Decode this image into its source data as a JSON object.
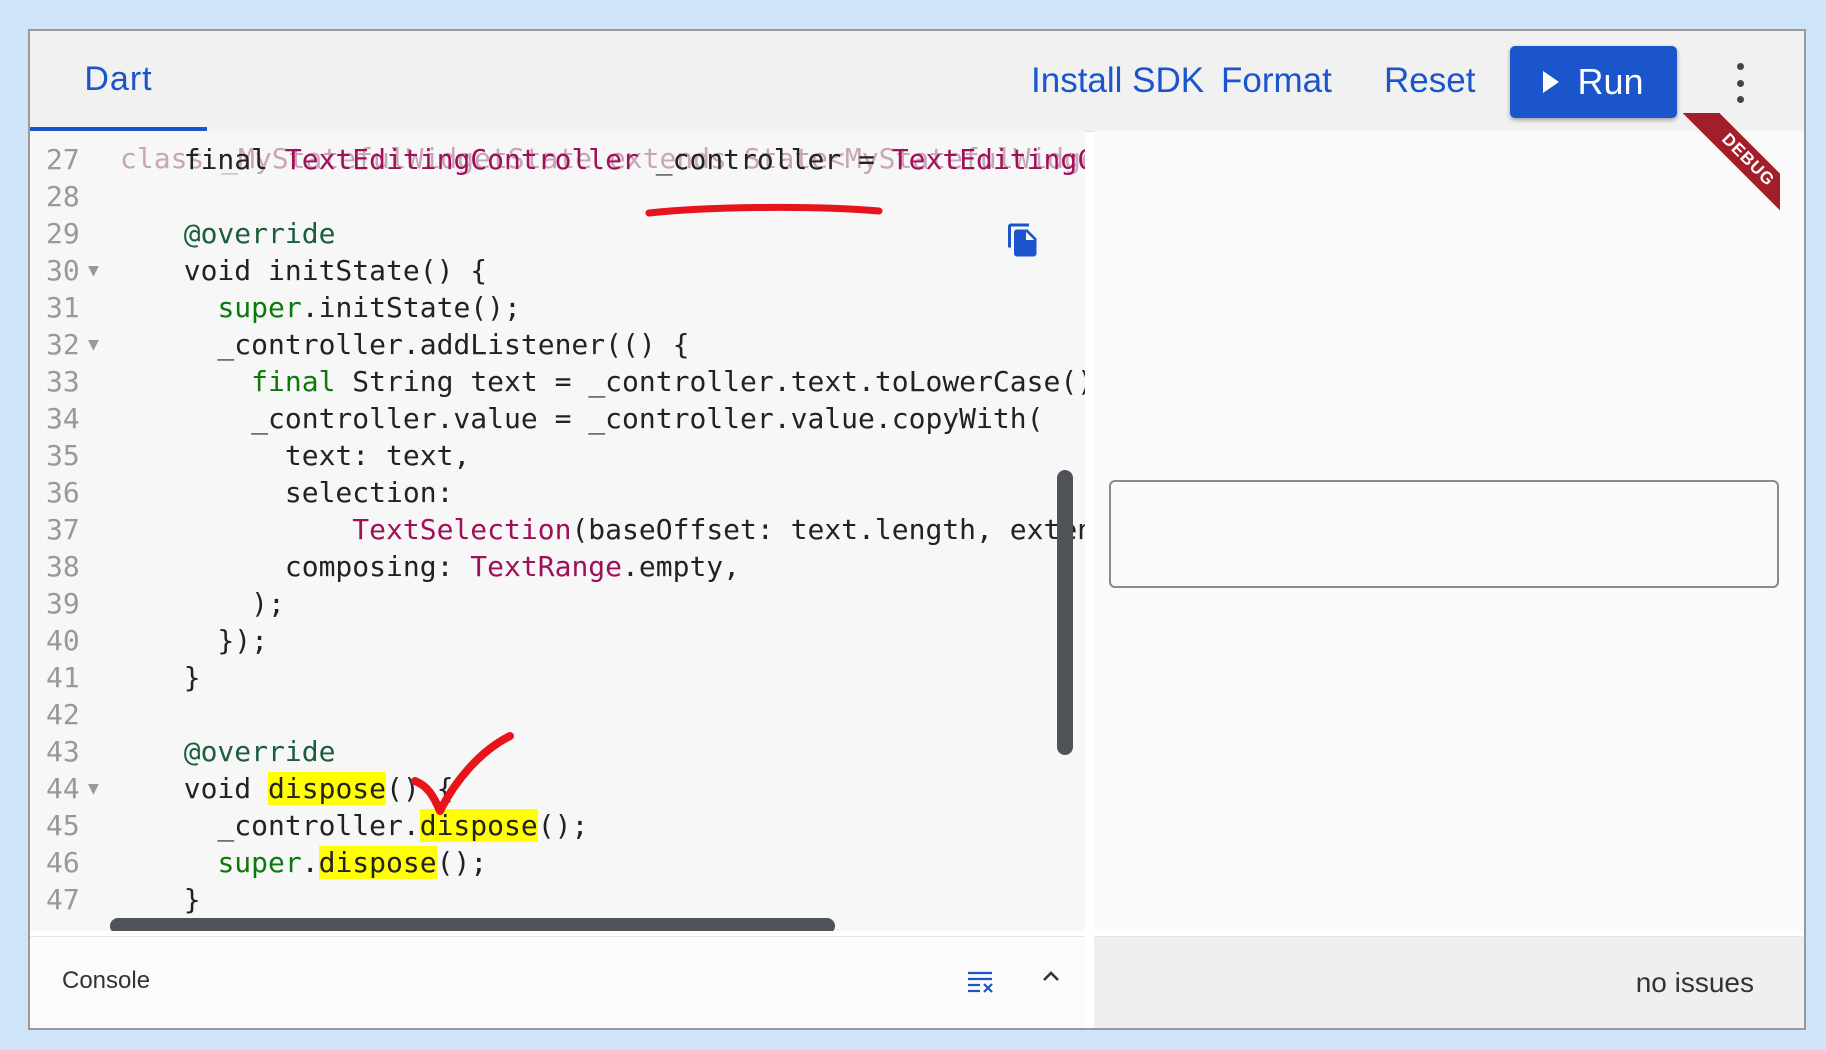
{
  "header": {
    "tab_label": "Dart",
    "install_sdk": "Install SDK",
    "format": "Format",
    "reset": "Reset",
    "run": "Run"
  },
  "editor": {
    "lines": [
      {
        "num": "27",
        "fold": false,
        "segments": [
          [
            "",
            "  "
          ],
          [
            "",
            "final "
          ],
          [
            "type",
            "TextEditingController"
          ],
          [
            "",
            " _controller = "
          ],
          [
            "type",
            "TextEditingCon"
          ]
        ]
      },
      {
        "num": "28",
        "fold": false,
        "segments": []
      },
      {
        "num": "29",
        "fold": false,
        "segments": [
          [
            "",
            "  "
          ],
          [
            "anno",
            "@override"
          ]
        ]
      },
      {
        "num": "30",
        "fold": true,
        "segments": [
          [
            "",
            "  void initState() {"
          ]
        ]
      },
      {
        "num": "31",
        "fold": false,
        "segments": [
          [
            "",
            "    "
          ],
          [
            "kw-green",
            "super"
          ],
          [
            "",
            ".initState();"
          ]
        ]
      },
      {
        "num": "32",
        "fold": true,
        "segments": [
          [
            "",
            "    _controller.addListener(() {"
          ]
        ]
      },
      {
        "num": "33",
        "fold": false,
        "segments": [
          [
            "",
            "      "
          ],
          [
            "kw-green",
            "final"
          ],
          [
            "",
            " String text = _controller.text.toLowerCase();"
          ]
        ]
      },
      {
        "num": "34",
        "fold": false,
        "segments": [
          [
            "",
            "      _controller.value = _controller.value.copyWith("
          ]
        ]
      },
      {
        "num": "35",
        "fold": false,
        "segments": [
          [
            "",
            "        text: text,"
          ]
        ]
      },
      {
        "num": "36",
        "fold": false,
        "segments": [
          [
            "",
            "        selection:"
          ]
        ]
      },
      {
        "num": "37",
        "fold": false,
        "segments": [
          [
            "",
            "            "
          ],
          [
            "type",
            "TextSelection"
          ],
          [
            "",
            "(baseOffset: text.length, exten"
          ]
        ]
      },
      {
        "num": "38",
        "fold": false,
        "segments": [
          [
            "",
            "        composing: "
          ],
          [
            "type",
            "TextRange"
          ],
          [
            "",
            ".empty,"
          ]
        ]
      },
      {
        "num": "39",
        "fold": false,
        "segments": [
          [
            "",
            "      );"
          ]
        ]
      },
      {
        "num": "40",
        "fold": false,
        "segments": [
          [
            "",
            "    });"
          ]
        ]
      },
      {
        "num": "41",
        "fold": false,
        "segments": [
          [
            "",
            "  }"
          ]
        ]
      },
      {
        "num": "42",
        "fold": false,
        "segments": []
      },
      {
        "num": "43",
        "fold": false,
        "segments": [
          [
            "",
            "  "
          ],
          [
            "anno",
            "@override"
          ]
        ]
      },
      {
        "num": "44",
        "fold": true,
        "segments": [
          [
            "",
            "  void "
          ],
          [
            "hl",
            "dispose"
          ],
          [
            "",
            "() {"
          ]
        ]
      },
      {
        "num": "45",
        "fold": false,
        "segments": [
          [
            "",
            "    _controller."
          ],
          [
            "hl",
            "dispose"
          ],
          [
            "",
            "();"
          ]
        ]
      },
      {
        "num": "46",
        "fold": false,
        "segments": [
          [
            "",
            "    "
          ],
          [
            "kw-green",
            "super"
          ],
          [
            "",
            "."
          ],
          [
            "hl",
            "dispose"
          ],
          [
            "",
            "();"
          ]
        ]
      },
      {
        "num": "47",
        "fold": false,
        "segments": [
          [
            "",
            "  }"
          ]
        ]
      }
    ]
  },
  "console": {
    "title": "Console"
  },
  "preview": {
    "debug_label": "DEBUG",
    "issues": "no issues"
  },
  "colors": {
    "accent": "#1a55cc",
    "type": "#a0105a",
    "keyword": "#0b7a0b",
    "highlight": "#ffff00",
    "annotation_red": "#e8141c"
  }
}
